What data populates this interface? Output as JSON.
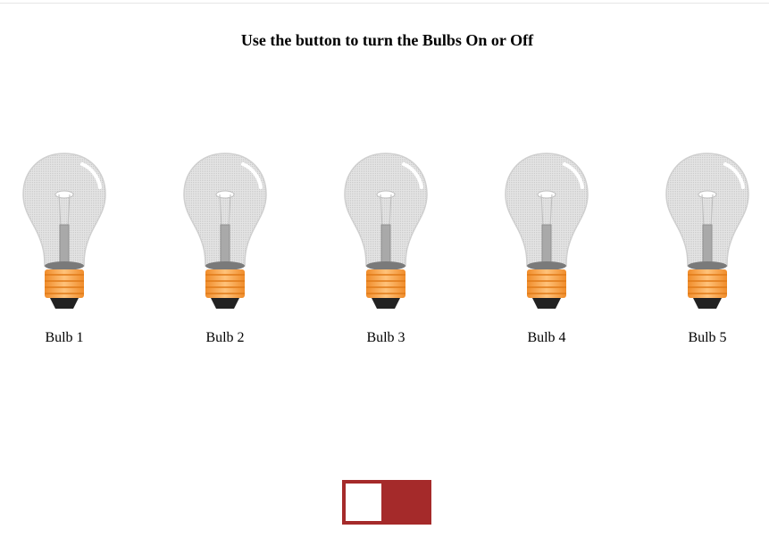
{
  "page": {
    "title": "Use the button to turn the Bulbs On or Off"
  },
  "bulbs": [
    {
      "label": "Bulb 1",
      "state": "off"
    },
    {
      "label": "Bulb 2",
      "state": "off"
    },
    {
      "label": "Bulb 3",
      "state": "off"
    },
    {
      "label": "Bulb 4",
      "state": "off"
    },
    {
      "label": "Bulb 5",
      "state": "off"
    }
  ],
  "toggle": {
    "state": "off",
    "color": "#a52a2a"
  },
  "colors": {
    "glass": "#d9d9d9",
    "base": "#f5a54a",
    "tip": "#222222"
  }
}
